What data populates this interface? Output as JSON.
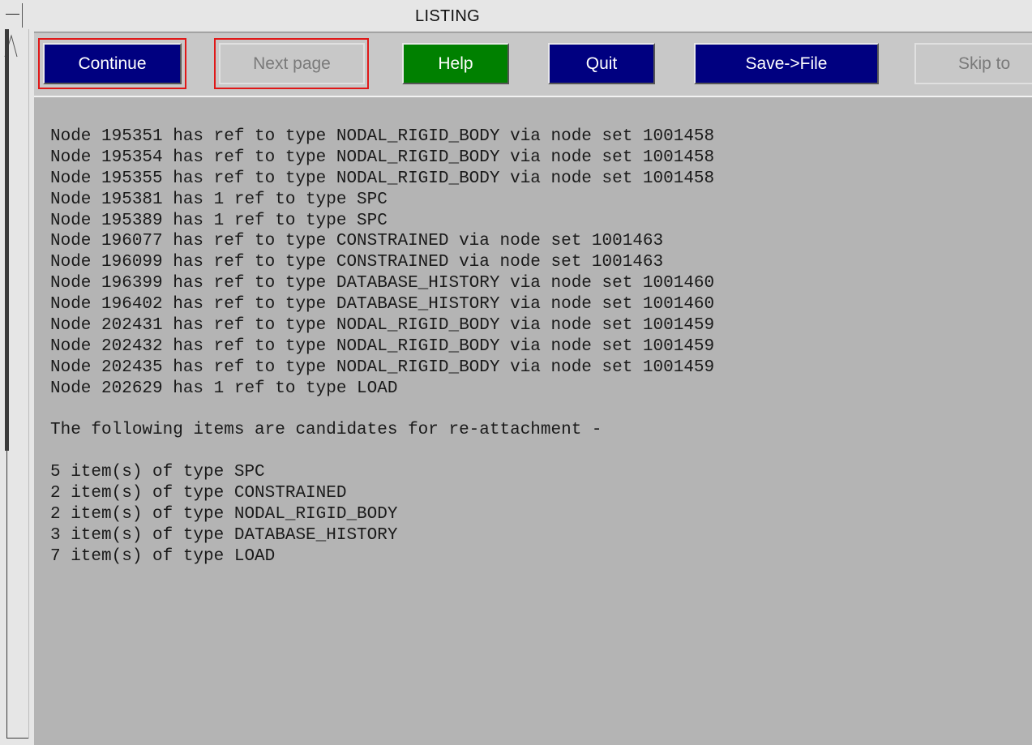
{
  "window": {
    "title": "LISTING"
  },
  "toolbar": {
    "buttons": [
      {
        "label": "Continue",
        "state": "active",
        "color": "#000080",
        "highlighted": true
      },
      {
        "label": "Next page",
        "state": "disabled",
        "highlighted": true
      },
      {
        "label": "Help",
        "state": "active",
        "color": "#008000"
      },
      {
        "label": "Quit",
        "state": "active",
        "color": "#000080"
      },
      {
        "label": "Save->File",
        "state": "active",
        "color": "#000080"
      },
      {
        "label": "Skip to",
        "state": "disabled"
      }
    ]
  },
  "listing": {
    "lines": [
      "Node 195351 has ref to type NODAL_RIGID_BODY via node set 1001458",
      "Node 195354 has ref to type NODAL_RIGID_BODY via node set 1001458",
      "Node 195355 has ref to type NODAL_RIGID_BODY via node set 1001458",
      "Node 195381 has 1 ref to type SPC",
      "Node 195389 has 1 ref to type SPC",
      "Node 196077 has ref to type CONSTRAINED via node set 1001463",
      "Node 196099 has ref to type CONSTRAINED via node set 1001463",
      "Node 196399 has ref to type DATABASE_HISTORY via node set 1001460",
      "Node 196402 has ref to type DATABASE_HISTORY via node set 1001460",
      "Node 202431 has ref to type NODAL_RIGID_BODY via node set 1001459",
      "Node 202432 has ref to type NODAL_RIGID_BODY via node set 1001459",
      "Node 202435 has ref to type NODAL_RIGID_BODY via node set 1001459",
      "Node 202629 has 1 ref to type LOAD",
      "",
      "The following items are candidates for re-attachment -",
      "",
      "5 item(s) of type SPC",
      "2 item(s) of type CONSTRAINED",
      "2 item(s) of type NODAL_RIGID_BODY",
      "3 item(s) of type DATABASE_HISTORY",
      "7 item(s) of type LOAD"
    ]
  }
}
